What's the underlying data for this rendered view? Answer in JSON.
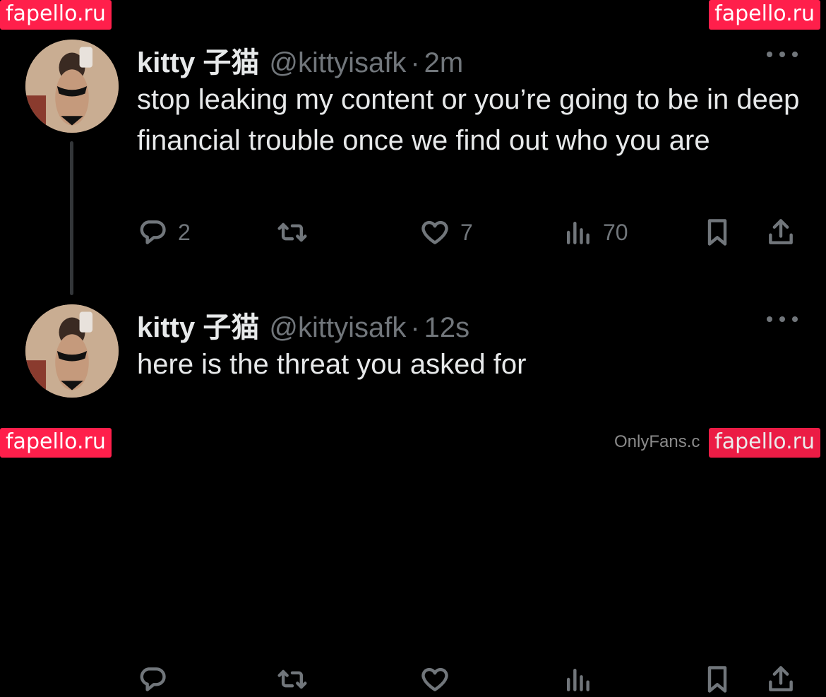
{
  "watermarks": {
    "top_left": "fapello.ru",
    "top_right": "fapello.ru",
    "bottom_left": "fapello.ru",
    "bottom_right": "fapello.ru"
  },
  "footer_text": "OnlyFans.c",
  "tweets": [
    {
      "name": "kitty 子猫",
      "handle": "@kittyisafk",
      "separator": "·",
      "time": "2m",
      "text": "stop leaking my content or you’re going to be in deep financial trouble once we find out who you are",
      "replies": "2",
      "retweets": "",
      "likes": "7",
      "views": "70"
    },
    {
      "name": "kitty 子猫",
      "handle": "@kittyisafk",
      "separator": "·",
      "time": "12s",
      "text": "here is the threat you asked for",
      "replies": "",
      "retweets": "",
      "likes": "",
      "views": ""
    }
  ],
  "icons": {
    "reply": "reply-icon",
    "retweet": "retweet-icon",
    "like": "heart-icon",
    "views": "views-chart-icon",
    "bookmark": "bookmark-icon",
    "share": "share-icon",
    "more": "more-dots-icon"
  },
  "colors": {
    "background": "#000000",
    "text": "#e7e9ea",
    "muted": "#71767b",
    "watermark": "#ff1f4b"
  }
}
